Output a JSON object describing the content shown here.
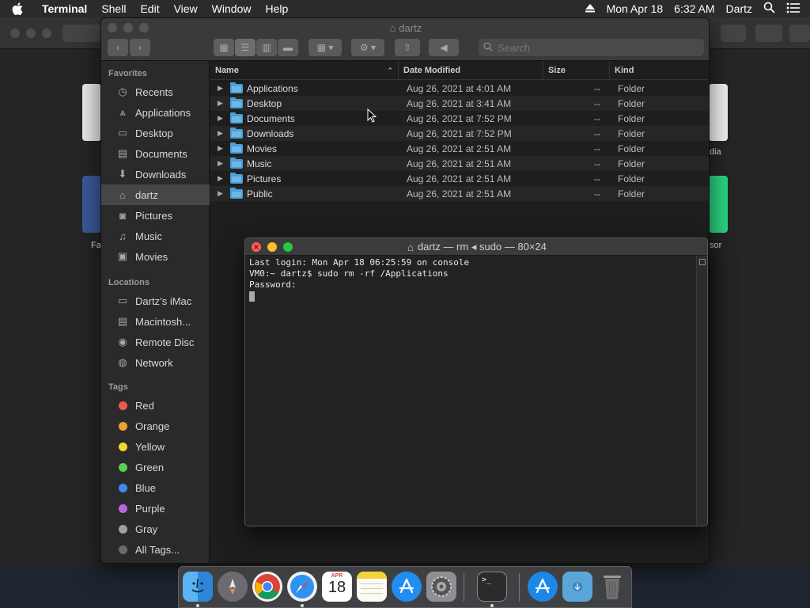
{
  "menubar": {
    "app_name": "Terminal",
    "items": [
      "Shell",
      "Edit",
      "View",
      "Window",
      "Help"
    ],
    "date": "Mon Apr 18",
    "time": "6:32 AM",
    "user": "Dartz"
  },
  "background": {
    "tile_label_1": "dia",
    "tile_label_2": "Fa",
    "tile_label_3": "sor"
  },
  "finder": {
    "title": "dartz",
    "search_placeholder": "Search",
    "sidebar": {
      "favorites_header": "Favorites",
      "favorites": [
        {
          "label": "Recents",
          "icon": "clock-icon"
        },
        {
          "label": "Applications",
          "icon": "applications-icon"
        },
        {
          "label": "Desktop",
          "icon": "desktop-icon"
        },
        {
          "label": "Documents",
          "icon": "document-icon"
        },
        {
          "label": "Downloads",
          "icon": "download-icon"
        },
        {
          "label": "dartz",
          "icon": "home-icon"
        },
        {
          "label": "Pictures",
          "icon": "camera-icon"
        },
        {
          "label": "Music",
          "icon": "music-icon"
        },
        {
          "label": "Movies",
          "icon": "film-icon"
        }
      ],
      "selected": "dartz",
      "locations_header": "Locations",
      "locations": [
        {
          "label": "Dartz’s iMac",
          "icon": "imac-icon"
        },
        {
          "label": "Macintosh...",
          "icon": "disk-icon"
        },
        {
          "label": "Remote Disc",
          "icon": "disc-icon"
        },
        {
          "label": "Network",
          "icon": "globe-icon"
        }
      ],
      "tags_header": "Tags",
      "tags": [
        {
          "label": "Red",
          "color": "#ee5a52"
        },
        {
          "label": "Orange",
          "color": "#f0a02c"
        },
        {
          "label": "Yellow",
          "color": "#f5d733"
        },
        {
          "label": "Green",
          "color": "#5ad04e"
        },
        {
          "label": "Blue",
          "color": "#3a8ef0"
        },
        {
          "label": "Purple",
          "color": "#b766de"
        },
        {
          "label": "Gray",
          "color": "#a0a0a0"
        },
        {
          "label": "All Tags...",
          "color": "#6a6a6a"
        }
      ]
    },
    "columns": {
      "name": "Name",
      "date": "Date Modified",
      "size": "Size",
      "kind": "Kind"
    },
    "rows": [
      {
        "name": "Applications",
        "date": "Aug 26, 2021 at 4:01 AM",
        "size": "--",
        "kind": "Folder"
      },
      {
        "name": "Desktop",
        "date": "Aug 26, 2021 at 3:41 AM",
        "size": "--",
        "kind": "Folder"
      },
      {
        "name": "Documents",
        "date": "Aug 26, 2021 at 7:52 PM",
        "size": "--",
        "kind": "Folder"
      },
      {
        "name": "Downloads",
        "date": "Aug 26, 2021 at 7:52 PM",
        "size": "--",
        "kind": "Folder"
      },
      {
        "name": "Movies",
        "date": "Aug 26, 2021 at 2:51 AM",
        "size": "--",
        "kind": "Folder"
      },
      {
        "name": "Music",
        "date": "Aug 26, 2021 at 2:51 AM",
        "size": "--",
        "kind": "Folder"
      },
      {
        "name": "Pictures",
        "date": "Aug 26, 2021 at 2:51 AM",
        "size": "--",
        "kind": "Folder"
      },
      {
        "name": "Public",
        "date": "Aug 26, 2021 at 2:51 AM",
        "size": "--",
        "kind": "Folder"
      }
    ]
  },
  "terminal": {
    "title": "dartz — rm ◂ sudo — 80×24",
    "lines": [
      "Last login: Mon Apr 18 06:25:59 on console",
      "VM0:~ dartz$ sudo rm -rf /Applications",
      "Password:"
    ]
  },
  "dock": {
    "items": [
      {
        "name": "finder-icon",
        "running": true
      },
      {
        "name": "launchpad-icon",
        "running": false
      },
      {
        "name": "chrome-icon",
        "running": false
      },
      {
        "name": "safari-icon",
        "running": true
      },
      {
        "name": "calendar-icon",
        "running": false
      },
      {
        "name": "notes-icon",
        "running": false
      },
      {
        "name": "app-store-icon",
        "running": false
      },
      {
        "name": "system-preferences-icon",
        "running": false
      },
      {
        "name": "terminal-icon",
        "running": true
      },
      {
        "name": "applications-folder-icon",
        "running": false
      },
      {
        "name": "downloads-folder-icon",
        "running": false
      },
      {
        "name": "trash-icon",
        "running": false
      }
    ],
    "calendar_month": "APR",
    "calendar_day": "18"
  }
}
